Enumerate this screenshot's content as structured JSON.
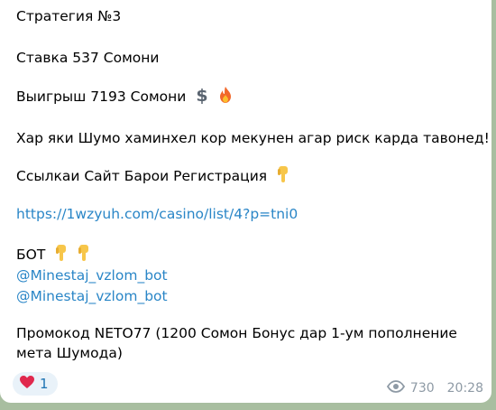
{
  "message": {
    "line1": "Стратегия №3",
    "line2": "Ставка 537 Сомони",
    "line3": "Выигрыш 7193 Сомони",
    "line3_emojis": [
      "dollar-icon",
      "fire-icon"
    ],
    "line4": "Хар яки Шумо хаминхел кор мекунен агар риск карда тавонед!",
    "line5": "Ссылкаи Сайт Барои Регистрация",
    "line5_emoji": "finger-down-icon",
    "link": "https://1wzyuh.com/casino/list/4?p=tni0",
    "bot_label": "БОТ",
    "bot_handles": [
      "@Minestaj_vzlom_bot",
      "@Minestaj_vzlom_bot"
    ],
    "promo": "Промокод NETO77 (1200 Сомон Бонус дар 1-ум пополнение мета Шумода)"
  },
  "reaction": {
    "icon": "heart-icon",
    "count": "1"
  },
  "meta": {
    "views": "730",
    "time": "20:28",
    "views_icon": "eye-icon"
  },
  "colors": {
    "link": "#2a86c7",
    "meta": "#8e9aa5",
    "reaction_bg": "#e9f2f9",
    "heart": "#e0284d"
  }
}
